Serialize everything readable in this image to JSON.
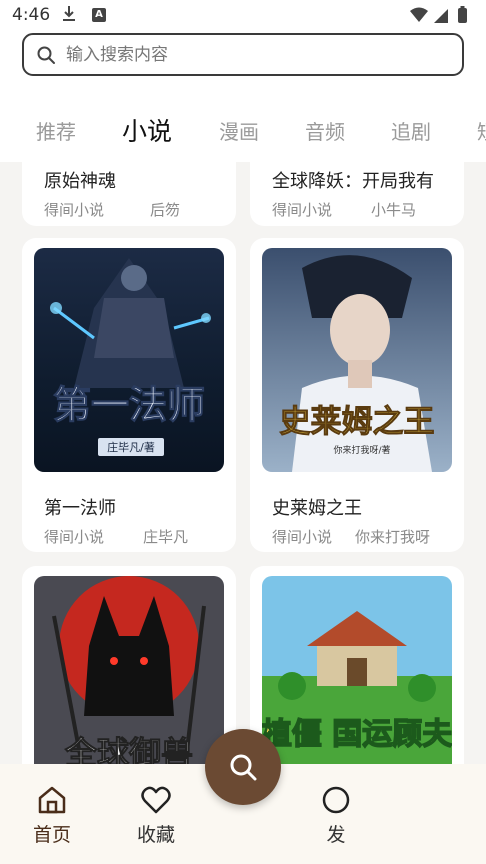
{
  "status_bar": {
    "time": "4:46",
    "notification_badge": "A"
  },
  "search": {
    "placeholder": "输入搜索内容"
  },
  "tabs": [
    {
      "label": "推荐",
      "active": false
    },
    {
      "label": "小说",
      "active": true
    },
    {
      "label": "漫画",
      "active": false
    },
    {
      "label": "音频",
      "active": false
    },
    {
      "label": "追剧",
      "active": false
    },
    {
      "label": "短",
      "active": false
    }
  ],
  "books": [
    {
      "title": "原始神魂",
      "source": "得间小说",
      "author": "后笏"
    },
    {
      "title": "全球降妖：开局我有",
      "source": "得间小说",
      "author": "小牛马"
    },
    {
      "title": "第一法师",
      "source": "得间小说",
      "author": "庄毕凡",
      "cover_text": "第一法师",
      "cover_author": "庄毕凡/著"
    },
    {
      "title": "史莱姆之王",
      "source": "得间小说",
      "author": "你来打我呀",
      "cover_text": "史莱姆之王",
      "cover_author": "你来打我呀/著"
    },
    {
      "cover_text": "全球御兽"
    },
    {
      "cover_text": "植僵 国运顾夫"
    }
  ],
  "bottom_nav": [
    {
      "label": "首页",
      "icon": "home-icon",
      "active": true
    },
    {
      "label": "收藏",
      "icon": "heart-icon",
      "active": false
    },
    {
      "label": "发",
      "icon": "discover-icon",
      "active": false
    }
  ],
  "fab": {
    "icon": "search-icon"
  },
  "colors": {
    "accent": "#6b4a33",
    "nav_bg": "#fbf8f2",
    "page_bg": "#f5f4f2"
  }
}
